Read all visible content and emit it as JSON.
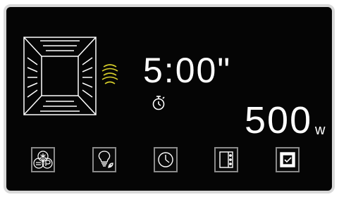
{
  "display": {
    "time": "5:00\"",
    "power": "500",
    "power_unit": "w"
  },
  "icons": {
    "oven": "oven-cavity-icon",
    "heat": "heat-waves-icon",
    "timer": "stopwatch-icon"
  },
  "buttons": [
    {
      "name": "defrost-eco-button",
      "icon": "snowflake-p-icon"
    },
    {
      "name": "light-eco-button",
      "icon": "bulb-leaf-icon"
    },
    {
      "name": "clock-button",
      "icon": "clock-icon"
    },
    {
      "name": "mode-button",
      "icon": "panel-dots-icon"
    },
    {
      "name": "confirm-button",
      "icon": "checkbox-icon"
    }
  ],
  "colors": {
    "background": "#050505",
    "foreground": "#ffffff",
    "accent": "#d8cf2a",
    "border": "#8a8a8a"
  }
}
